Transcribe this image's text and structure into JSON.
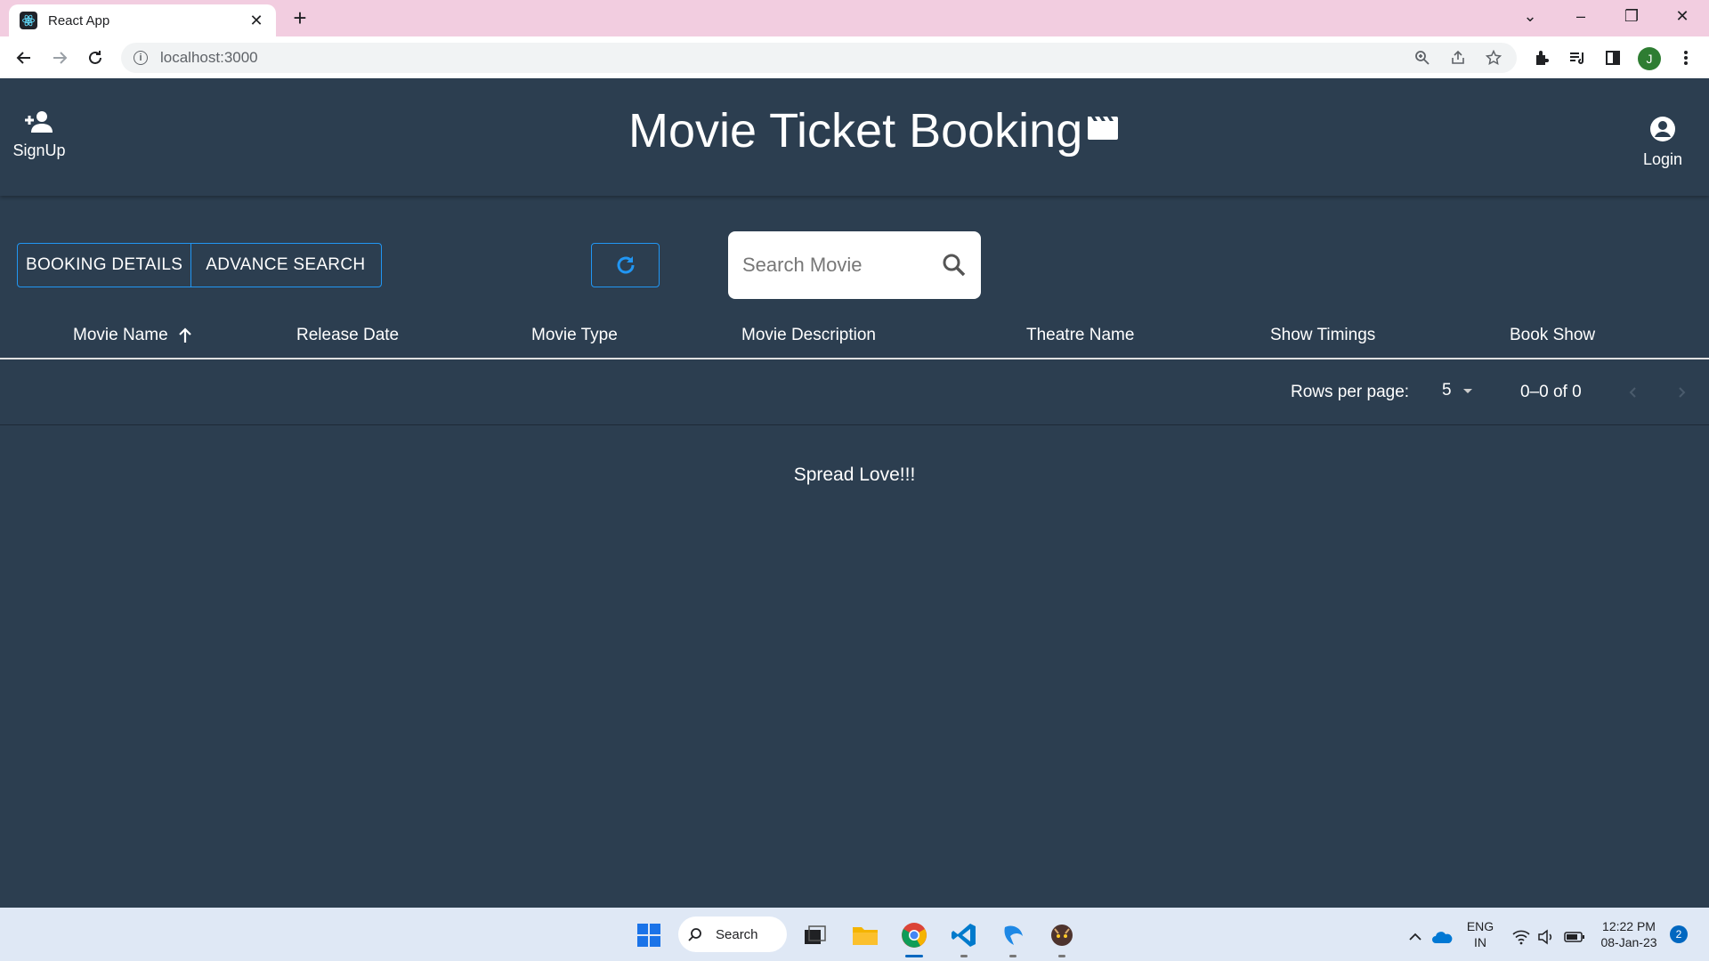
{
  "browser": {
    "tab_title": "React App",
    "url": "localhost:3000"
  },
  "header": {
    "signup_label": "SignUp",
    "title": "Movie Ticket Booking",
    "login_label": "Login"
  },
  "controls": {
    "booking_details_label": "BOOKING DETAILS",
    "advance_search_label": "ADVANCE SEARCH",
    "search_placeholder": "Search Movie"
  },
  "table": {
    "columns": [
      "Movie Name",
      "Release Date",
      "Movie Type",
      "Movie Description",
      "Theatre Name",
      "Show Timings",
      "Book Show"
    ],
    "sort_column": "Movie Name",
    "sort_direction": "asc",
    "rows": []
  },
  "pagination": {
    "rows_per_page_label": "Rows per page:",
    "rows_per_page_value": "5",
    "range_text": "0–0 of 0"
  },
  "footer": {
    "text": "Spread Love!!!"
  },
  "taskbar": {
    "search_label": "Search",
    "lang_line1": "ENG",
    "lang_line2": "IN",
    "time": "12:22 PM",
    "date": "08-Jan-23",
    "notification_count": "2"
  },
  "colors": {
    "background": "#2c3e50",
    "accent": "#2196f3",
    "tabstrip": "#f2cde0"
  }
}
